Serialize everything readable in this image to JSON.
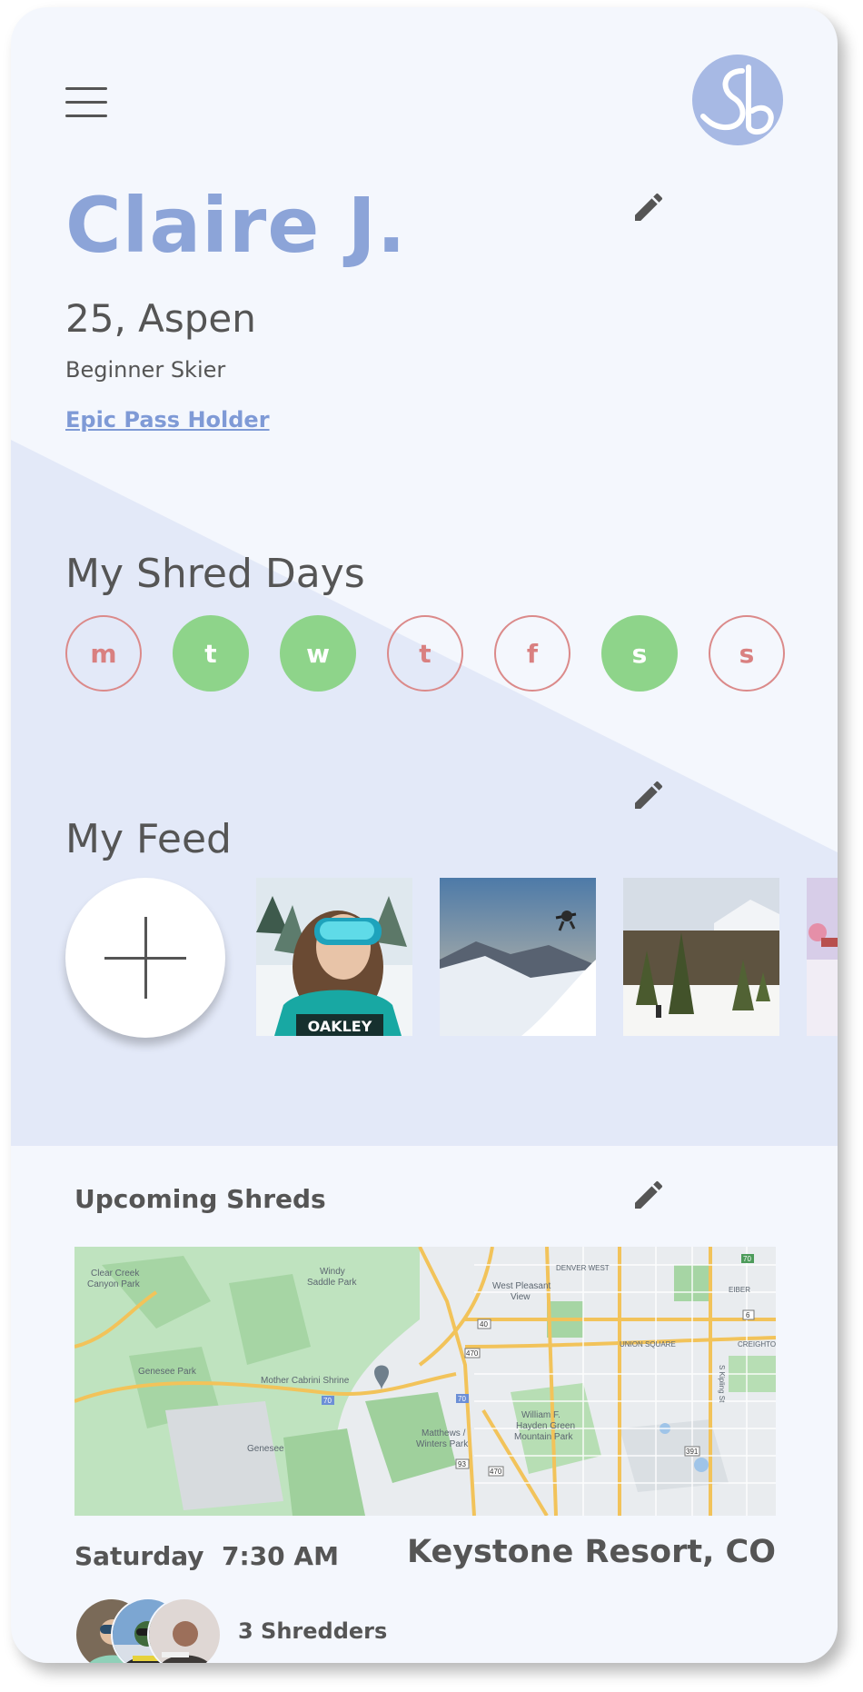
{
  "logo": {
    "letters": "Sb"
  },
  "profile": {
    "name": "Claire J.",
    "subline": "25, Aspen",
    "level": "Beginner Skier",
    "pass": "Epic Pass Holder"
  },
  "shred_days": {
    "title": "My Shred Days",
    "days": [
      {
        "letter": "m",
        "active": false
      },
      {
        "letter": "t",
        "active": true
      },
      {
        "letter": "w",
        "active": true
      },
      {
        "letter": "t",
        "active": false
      },
      {
        "letter": "f",
        "active": false
      },
      {
        "letter": "s",
        "active": true
      },
      {
        "letter": "s",
        "active": false
      }
    ]
  },
  "feed": {
    "title": "My Feed",
    "photos": [
      "photo-skier-goggles",
      "photo-skier-jump",
      "photo-pine-trees",
      "photo-partial"
    ],
    "goggle_brand": "OAKLEY"
  },
  "upcoming": {
    "title": "Upcoming Shreds",
    "day": "Saturday",
    "time": "7:30 AM",
    "location": "Keystone Resort, CO",
    "shredders": "3 Shredders",
    "map_labels": {
      "clear_creek": "Clear Creek",
      "canyon_park": "Canyon Park",
      "windy": "Windy",
      "saddle_park": "Saddle Park",
      "west_pleasant": "West Pleasant",
      "view": "View",
      "denver_west": "DENVER WEST",
      "eiber": "EIBER",
      "union_square": "UNION SQUARE",
      "creighton": "CREIGHTON",
      "genesee_park": "Genesee Park",
      "mother_cabrini": "Mother Cabrini Shrine",
      "genesee": "Genesee",
      "matthews1": "Matthews /",
      "matthews2": "Winters Park",
      "hayden1": "William F.",
      "hayden2": "Hayden Green",
      "hayden3": "Mountain Park",
      "kipling": "S Kipling St",
      "shield_40": "40",
      "shield_470": "470",
      "shield_70a": "70",
      "shield_70b": "70",
      "shield_93": "93",
      "shield_6": "6",
      "shield_391": "391",
      "shield_470b": "470",
      "shield_top": "70"
    }
  },
  "colors": {
    "name_blue": "#8ca4d8",
    "active_day": "#8ed48a",
    "inactive_day": "#db8a8a",
    "section_bg": "#e3e9f8",
    "card_bg": "#f4f7fd"
  }
}
